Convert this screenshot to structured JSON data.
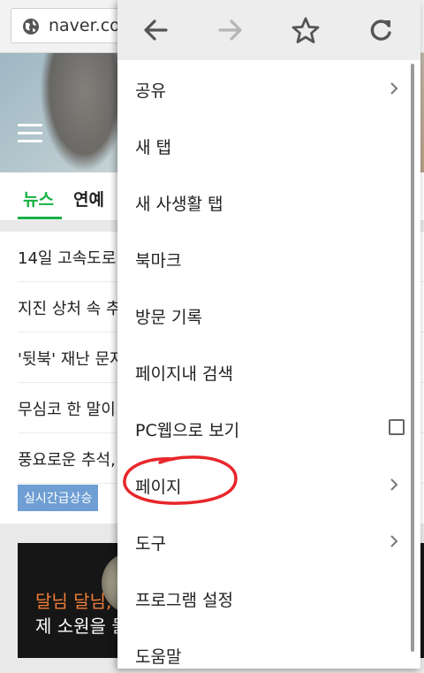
{
  "browser": {
    "url": "naver.co"
  },
  "page": {
    "tabs": [
      "뉴스",
      "연예"
    ],
    "news": [
      "14일 고속도로",
      "지진 상처 속 추",
      "'뒷북' 재난 문자",
      "무심코 한 말이",
      "풍요로운 추석,"
    ],
    "badge": "실시간급상승",
    "banner": {
      "title": "달님 달님,",
      "subtitle": "제 소원을 들"
    }
  },
  "menu": {
    "icons": [
      "back-arrow-icon",
      "forward-arrow-icon",
      "bookmark-star-icon",
      "reload-icon"
    ],
    "items": [
      {
        "label": "공유",
        "submenu": true
      },
      {
        "label": "새 탭"
      },
      {
        "label": "새 사생활 탭"
      },
      {
        "label": "북마크"
      },
      {
        "label": "방문 기록"
      },
      {
        "label": "페이지내 검색"
      },
      {
        "label": "PC웹으로 보기",
        "checkbox": false
      },
      {
        "label": "페이지",
        "submenu": true
      },
      {
        "label": "도구",
        "submenu": true
      },
      {
        "label": "프로그램 설정"
      },
      {
        "label": "도움말"
      }
    ]
  },
  "colors": {
    "accent_green": "#16b144",
    "annotation_red": "#e8262b",
    "badge_blue": "#6e9ed3"
  }
}
